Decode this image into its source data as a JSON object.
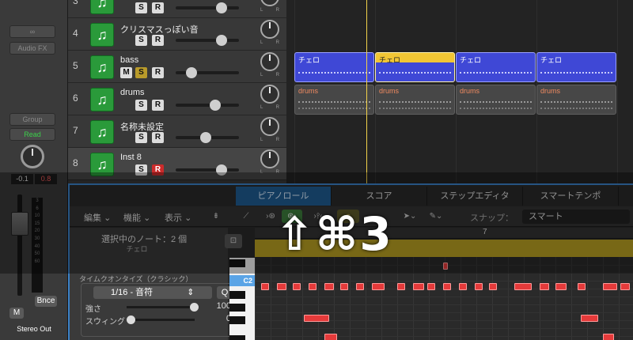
{
  "inspector": {
    "link_icon": "link-icon",
    "audio_fx": "Audio FX",
    "group": "Group",
    "read": "Read",
    "val_left": "-0.1",
    "val_right": "0.8",
    "meter_scale": [
      "3",
      "6",
      "10",
      "15",
      "20",
      "30",
      "40",
      "50",
      "60"
    ],
    "bounce": "Bnce",
    "mute": "M",
    "output": "Stereo Out"
  },
  "tracks": [
    {
      "num": "3",
      "name": "",
      "s": "S",
      "r": "R",
      "vol": 0.72,
      "mute": ""
    },
    {
      "num": "4",
      "name": "クリスマスっぽい音",
      "s": "S",
      "r": "R",
      "vol": 0.72,
      "mute": ""
    },
    {
      "num": "5",
      "name": "bass",
      "s": "S",
      "r": "R",
      "vol": 0.25,
      "mute": "M"
    },
    {
      "num": "6",
      "name": "drums",
      "s": "S",
      "r": "R",
      "vol": 0.62,
      "mute": ""
    },
    {
      "num": "7",
      "name": "名称未設定",
      "s": "S",
      "r": "R",
      "vol": 0.48,
      "mute": ""
    },
    {
      "num": "8",
      "name": "Inst 8",
      "s": "S",
      "r": "R",
      "vol": 0.72,
      "mute": ""
    }
  ],
  "regions": {
    "bass_label": "チェロ",
    "drums_label": "drums"
  },
  "editor": {
    "tabs": [
      "ピアノロール",
      "スコア",
      "ステップエディタ",
      "スマートテンポ"
    ],
    "menus": [
      "編集",
      "機能",
      "表示"
    ],
    "snap_label": "スナップ：",
    "snap_value": "スマート",
    "selected_notes": "選択中のノート：2 個",
    "selected_region": "チェロ",
    "quantize_header": "タイムクオンタイズ（クラシック）",
    "quantize_value": "1/16 - 音符",
    "quantize_btn": "Q",
    "strength_label": "強さ",
    "strength_value": "100",
    "strength": 1.0,
    "swing_label": "スウィング",
    "swing_value": "0",
    "swing": 0.0,
    "bar_number": "7",
    "key_label": "C2"
  },
  "overlay": {
    "shortcut": "⇧⌘3"
  }
}
